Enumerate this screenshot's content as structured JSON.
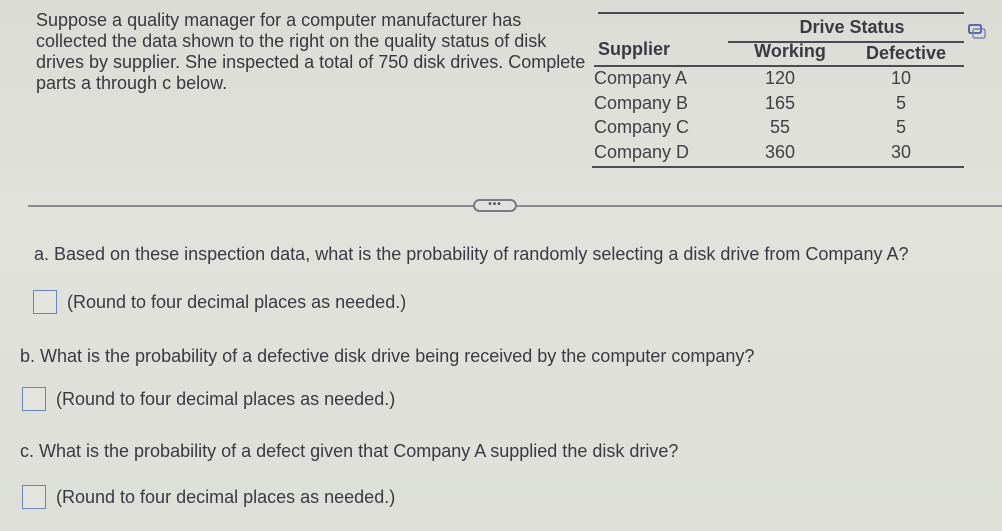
{
  "intro": {
    "text": "Suppose a quality manager for a computer manufacturer has collected the data shown to the right on the quality status of disk drives by supplier. She inspected a total of 750 disk drives. Complete parts a through c below."
  },
  "table": {
    "group_header": "Drive Status",
    "columns": [
      "Supplier",
      "Working",
      "Defective"
    ],
    "rows": [
      {
        "supplier": "Company A",
        "working": "120",
        "defective": "10"
      },
      {
        "supplier": "Company B",
        "working": "165",
        "defective": "5"
      },
      {
        "supplier": "Company C",
        "working": "55",
        "defective": "5"
      },
      {
        "supplier": "Company D",
        "working": "360",
        "defective": "30"
      }
    ],
    "copy_icon": "copy-icon"
  },
  "divider": {
    "expand_label": "•••"
  },
  "questions": [
    {
      "label": "a. Based on these inspection data, what is the probability of randomly selecting a disk drive from Company A?",
      "answer_value": "",
      "hint": "(Round to four decimal places as needed.)"
    },
    {
      "label": "b. What is the probability of a defective disk drive being received by the computer company?",
      "answer_value": "",
      "hint": "(Round to four decimal places as needed.)"
    },
    {
      "label": "c. What is the probability of a defect given that Company A supplied the disk drive?",
      "answer_value": "",
      "hint": "(Round to four decimal places as needed.)"
    }
  ]
}
